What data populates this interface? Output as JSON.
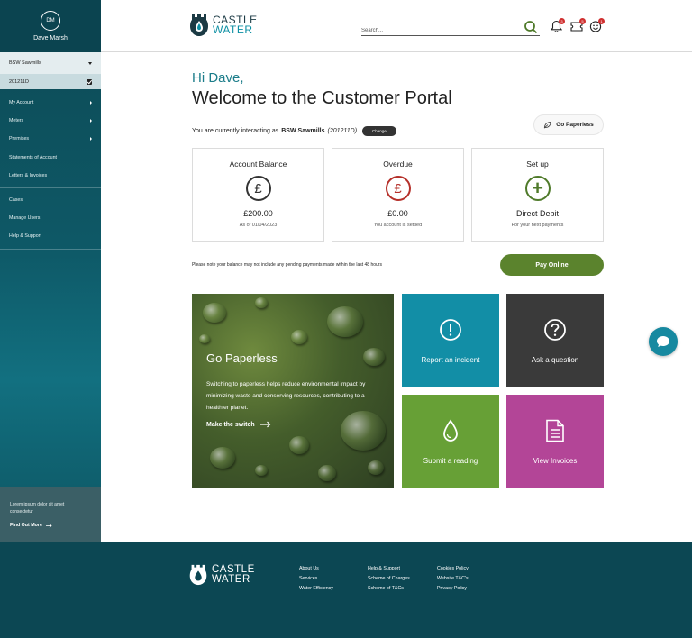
{
  "user": {
    "initials": "DM",
    "name": "Dave Marsh"
  },
  "account": {
    "selected": "BSW Sawmills",
    "id": "201211D"
  },
  "sidebar": {
    "items": [
      {
        "label": "My Account",
        "arrow": true
      },
      {
        "label": "Meters",
        "arrow": true
      },
      {
        "label": "Premises",
        "arrow": true
      },
      {
        "label": "Statements of Account",
        "arrow": false
      },
      {
        "label": "Letters & Invoices",
        "arrow": false
      }
    ],
    "items2": [
      {
        "label": "Cases"
      },
      {
        "label": "Manage Users"
      },
      {
        "label": "Help & Support"
      }
    ],
    "promo_text": "Lorem ipsum dolor sit amet consectetur",
    "promo_link": "Find Out More"
  },
  "header": {
    "logo_line1": "CASTLE",
    "logo_line2": "WATER",
    "search_placeholder": "Search...",
    "badges": {
      "notifications": "3",
      "messages": "5",
      "profile": "1"
    }
  },
  "main": {
    "greeting": "Hi Dave,",
    "welcome": "Welcome to the Customer Portal",
    "interacting_prefix": "You are currently interacting as",
    "interacting_account": "BSW Sawmills",
    "interacting_id": "(201211D)",
    "change_label": "Change",
    "go_paperless_label": "Go Paperless",
    "cards": [
      {
        "title": "Account Balance",
        "icon": "pound-icon",
        "symbol": "£",
        "value": "£200.00",
        "sub": "As of 01/04/2023",
        "color": "#333333"
      },
      {
        "title": "Overdue",
        "icon": "pound-icon",
        "symbol": "£",
        "value": "£0.00",
        "sub": "You account is settled",
        "color": "#b5302a"
      },
      {
        "title": "Set up",
        "icon": "plus-icon",
        "symbol": "+",
        "value": "Direct Debit",
        "sub": "For your next payments",
        "color": "#4f7a2a"
      }
    ],
    "note": "Please note your balance may not include any pending payments made within the last 48 hours",
    "pay_label": "Pay Online",
    "promo": {
      "title": "Go Paperless",
      "body": "Switching to paperless helps reduce environmental impact by minimizing waste and conserving resources, contributing to a healthier planet.",
      "link": "Make the switch"
    },
    "tiles": [
      {
        "label": "Report an incident",
        "icon": "exclamation-icon",
        "color": "#128ea6"
      },
      {
        "label": "Ask a question",
        "icon": "question-icon",
        "color": "#3a3a3a"
      },
      {
        "label": "Submit a reading",
        "icon": "water-drop-icon",
        "color": "#67a036"
      },
      {
        "label": "View Invoices",
        "icon": "document-icon",
        "color": "#b34597"
      }
    ]
  },
  "footer": {
    "logo_line1": "CASTLE",
    "logo_line2": "WATER",
    "col1": [
      "About Us",
      "Services",
      "Water Efficiency"
    ],
    "col2": [
      "Help & Support",
      "Scheme of Charges",
      "Scheme of T&Cs"
    ],
    "col3": [
      "Cookies Policy",
      "Website T&C's",
      "Privacy Policy"
    ]
  }
}
